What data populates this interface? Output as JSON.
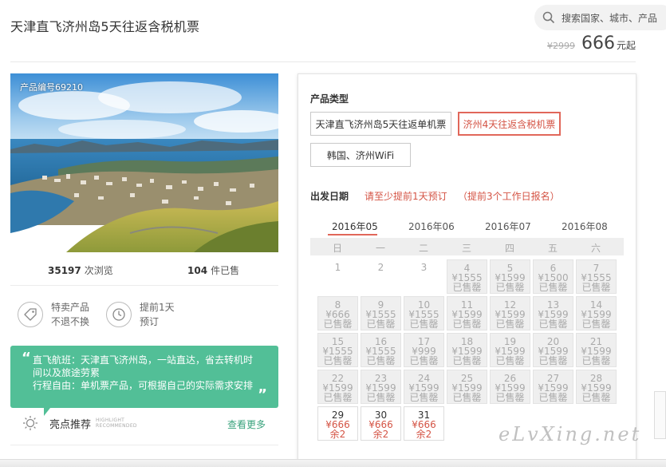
{
  "header": {
    "title": "天津直飞济州岛5天往返含税机票",
    "search_placeholder": "搜索国家、城市、产品",
    "original_price": "¥2999",
    "price": "666",
    "price_unit": "元起"
  },
  "product": {
    "code": "产品编号69210",
    "views_count": "35197",
    "views_label": "次浏览",
    "sold_count": "104",
    "sold_label": "件已售",
    "features": [
      {
        "icon": "tag-icon",
        "line1": "特卖产品",
        "line2": "不退不换"
      },
      {
        "icon": "clock-icon",
        "line1": "提前1天",
        "line2": "预订"
      }
    ],
    "description": {
      "line1": "直飞航班：天津直飞济州岛，一站直达，省去转机时",
      "line2": "间以及旅途劳累",
      "line3": "行程自由：单机票产品，可根据自己的实际需求安排"
    },
    "highlight_title": "亮点推荐",
    "highlight_sub1": "HIGHLIGHT",
    "highlight_sub2": "RECOMMENDED",
    "see_more": "查看更多"
  },
  "booking": {
    "type_label": "产品类型",
    "options": [
      {
        "label": "天津直飞济州岛5天往返单机票",
        "selected": false
      },
      {
        "label": "济州4天往返含税机票",
        "selected": true
      },
      {
        "label": "韩国、济州WiFi",
        "selected": false
      }
    ],
    "date_label": "出发日期",
    "note1": "请至少提前1天预订",
    "note2": "（提前3个工作日报名）",
    "months": [
      "2016年05",
      "2016年06",
      "2016年07",
      "2016年08"
    ],
    "active_month": 0,
    "weekdays": [
      "日",
      "一",
      "二",
      "三",
      "四",
      "五",
      "六"
    ],
    "calendar": [
      [
        {
          "d": "",
          "p": "",
          "s": "",
          "t": "empty"
        },
        {
          "d": "1",
          "p": "",
          "s": "",
          "t": "plain"
        },
        {
          "d": "2",
          "p": "",
          "s": "",
          "t": "plain"
        },
        {
          "d": "3",
          "p": "",
          "s": "",
          "t": "plain"
        },
        {
          "d": "4",
          "p": "¥1555",
          "s": "已售罄",
          "t": "sold"
        },
        {
          "d": "5",
          "p": "¥1599",
          "s": "已售罄",
          "t": "sold"
        },
        {
          "d": "6",
          "p": "¥1500",
          "s": "已售罄",
          "t": "sold"
        },
        {
          "d": "7",
          "p": "¥1555",
          "s": "已售罄",
          "t": "sold"
        }
      ],
      [
        {
          "d": "8",
          "p": "¥666",
          "s": "已售罄",
          "t": "sold"
        },
        {
          "d": "9",
          "p": "¥1555",
          "s": "已售罄",
          "t": "sold"
        },
        {
          "d": "10",
          "p": "¥1555",
          "s": "已售罄",
          "t": "sold"
        },
        {
          "d": "11",
          "p": "¥1599",
          "s": "已售罄",
          "t": "sold"
        },
        {
          "d": "12",
          "p": "¥1599",
          "s": "已售罄",
          "t": "sold"
        },
        {
          "d": "13",
          "p": "¥1599",
          "s": "已售罄",
          "t": "sold"
        },
        {
          "d": "14",
          "p": "¥1599",
          "s": "已售罄",
          "t": "sold"
        }
      ],
      [
        {
          "d": "15",
          "p": "¥1555",
          "s": "已售罄",
          "t": "sold"
        },
        {
          "d": "16",
          "p": "¥1555",
          "s": "已售罄",
          "t": "sold"
        },
        {
          "d": "17",
          "p": "¥999",
          "s": "已售罄",
          "t": "sold"
        },
        {
          "d": "18",
          "p": "¥1599",
          "s": "已售罄",
          "t": "sold"
        },
        {
          "d": "19",
          "p": "¥1599",
          "s": "已售罄",
          "t": "sold"
        },
        {
          "d": "20",
          "p": "¥1599",
          "s": "已售罄",
          "t": "sold"
        },
        {
          "d": "21",
          "p": "¥1599",
          "s": "已售罄",
          "t": "sold"
        }
      ],
      [
        {
          "d": "22",
          "p": "¥1599",
          "s": "已售罄",
          "t": "sold"
        },
        {
          "d": "23",
          "p": "¥1599",
          "s": "已售罄",
          "t": "sold"
        },
        {
          "d": "24",
          "p": "¥1599",
          "s": "已售罄",
          "t": "sold"
        },
        {
          "d": "25",
          "p": "¥1599",
          "s": "已售罄",
          "t": "sold"
        },
        {
          "d": "26",
          "p": "¥1599",
          "s": "已售罄",
          "t": "sold"
        },
        {
          "d": "27",
          "p": "¥1599",
          "s": "已售罄",
          "t": "sold"
        },
        {
          "d": "28",
          "p": "¥1599",
          "s": "已售罄",
          "t": "sold"
        }
      ],
      [
        {
          "d": "29",
          "p": "¥666",
          "s": "余2",
          "t": "avail"
        },
        {
          "d": "30",
          "p": "¥666",
          "s": "余2",
          "t": "avail"
        },
        {
          "d": "31",
          "p": "¥666",
          "s": "余2",
          "t": "avail"
        }
      ]
    ]
  },
  "watermark": "eLvXing.net",
  "colors": {
    "accent_red": "#d45445",
    "green": "#52bf97",
    "link_green": "#3aa37d"
  }
}
